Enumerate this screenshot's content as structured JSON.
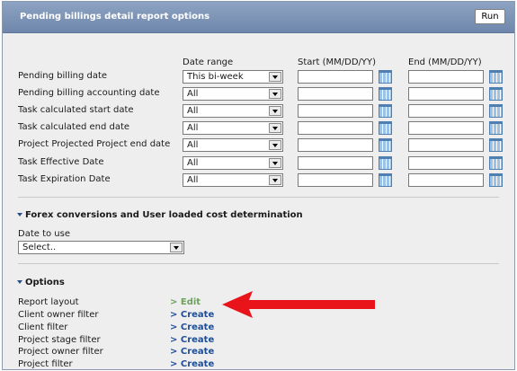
{
  "header": {
    "title": "Pending billings detail report options",
    "run_label": "Run"
  },
  "columns": {
    "date_range": "Date range",
    "start": "Start (MM/DD/YY)",
    "end": "End (MM/DD/YY)"
  },
  "date_rows": [
    {
      "label": "Pending billing date",
      "range": "This bi-week",
      "start": "",
      "end": ""
    },
    {
      "label": "Pending billing accounting date",
      "range": "All",
      "start": "",
      "end": ""
    },
    {
      "label": "Task calculated start date",
      "range": "All",
      "start": "",
      "end": ""
    },
    {
      "label": "Task calculated end date",
      "range": "All",
      "start": "",
      "end": ""
    },
    {
      "label": "Project Projected Project end date",
      "range": "All",
      "start": "",
      "end": ""
    },
    {
      "label": "Task Effective Date",
      "range": "All",
      "start": "",
      "end": ""
    },
    {
      "label": "Task Expiration Date",
      "range": "All",
      "start": "",
      "end": ""
    }
  ],
  "forex": {
    "title": "Forex conversions and User loaded cost determination",
    "date_label": "Date to use",
    "date_value": "Select.."
  },
  "options": {
    "title": "Options",
    "items": [
      {
        "label": "Report layout",
        "link": "> Edit"
      },
      {
        "label": "Client owner filter",
        "link": "> Create"
      },
      {
        "label": "Client filter",
        "link": "> Create"
      },
      {
        "label": "Project stage filter",
        "link": "> Create"
      },
      {
        "label": "Project owner filter",
        "link": "> Create"
      },
      {
        "label": "Project filter",
        "link": "> Create"
      }
    ]
  },
  "colors": {
    "header": "#7a91b5",
    "link": "#1f4e97",
    "edit_link": "#6fa060",
    "arrow": "#e8141a"
  },
  "icons": {
    "calendar": "calendar-icon",
    "dropdown": "chevron-down-icon",
    "pointer": "red-arrow"
  }
}
